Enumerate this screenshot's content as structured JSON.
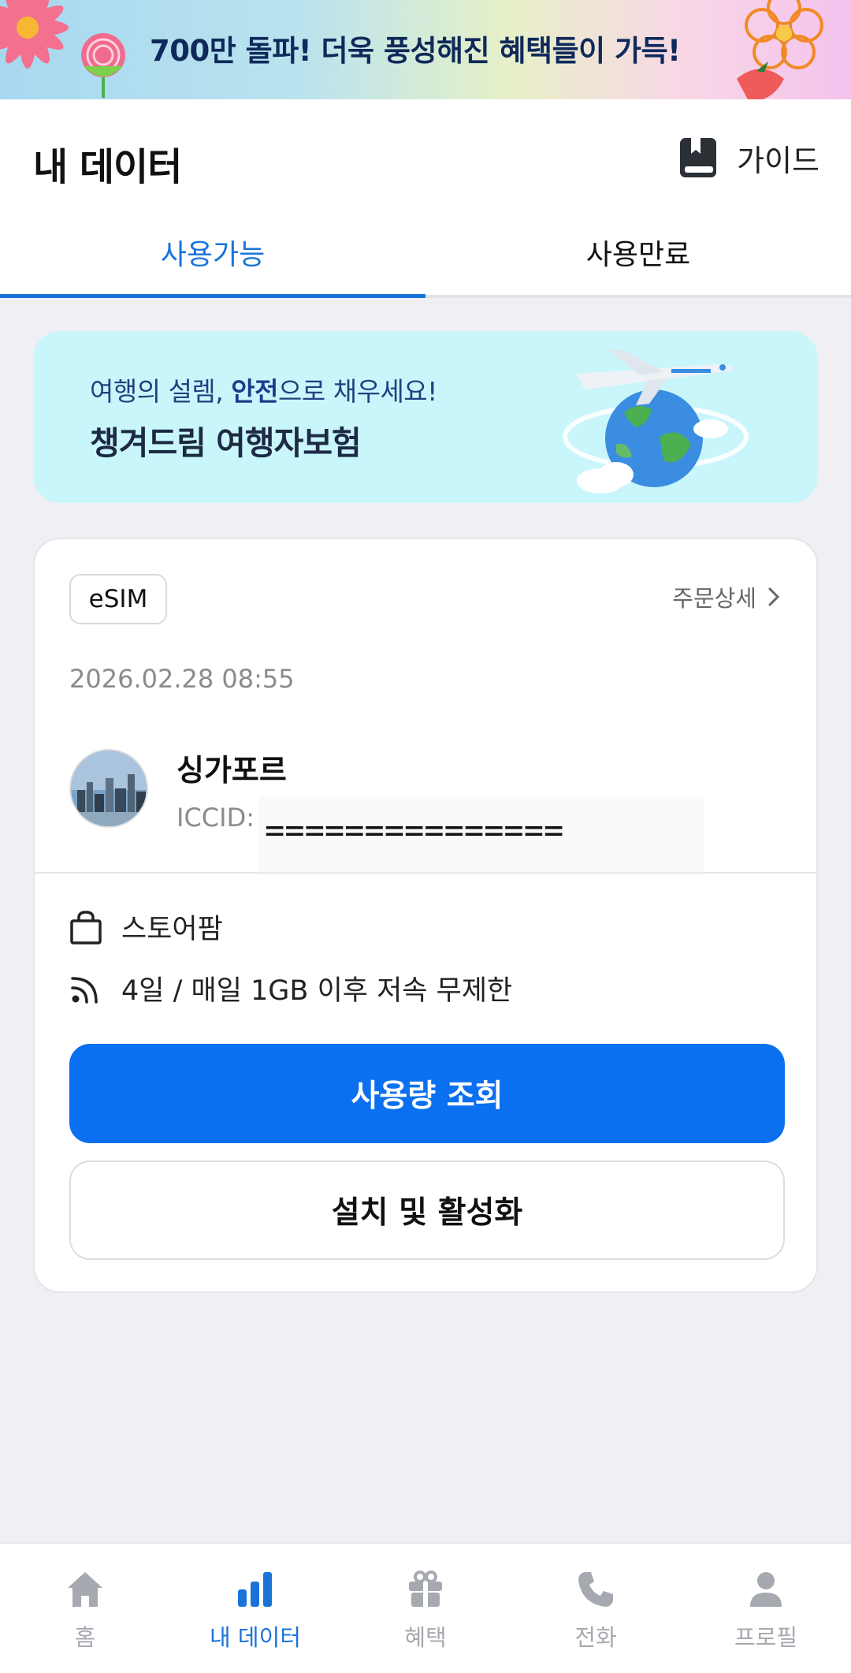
{
  "promo": {
    "text": "700만 돌파! 더욱 풍성해진 혜택들이 가득!"
  },
  "header": {
    "title": "내 데이터",
    "guide_label": "가이드"
  },
  "tabs": [
    {
      "label": "사용가능",
      "active": true
    },
    {
      "label": "사용만료",
      "active": false
    }
  ],
  "insurance_banner": {
    "line1_prefix": "여행의 설렘, ",
    "line1_bold": "안전",
    "line1_suffix": "으로 채우세요!",
    "line2": "챙겨드림 여행자보험"
  },
  "card": {
    "badge": "eSIM",
    "order_detail_label": "주문상세",
    "date": "2026.02.28 08:55",
    "country": "싱가포르",
    "iccid_label": "ICCID:",
    "iccid_value": "===============",
    "store": "스토어팜",
    "plan": "4일 / 매일 1GB 이후 저속 무제한",
    "primary_button": "사용량 조회",
    "secondary_button": "설치 및 활성화"
  },
  "bottom_nav": [
    {
      "label": "홈",
      "icon": "home-icon",
      "active": false
    },
    {
      "label": "내 데이터",
      "icon": "bar-chart-icon",
      "active": true
    },
    {
      "label": "혜택",
      "icon": "gift-icon",
      "active": false
    },
    {
      "label": "전화",
      "icon": "phone-icon",
      "active": false
    },
    {
      "label": "프로필",
      "icon": "profile-icon",
      "active": false
    }
  ],
  "colors": {
    "accent": "#1a73d9",
    "primary_button": "#0a70f0",
    "inactive_nav": "#a7a9b0",
    "banner_bg": "#c9f6fb"
  }
}
